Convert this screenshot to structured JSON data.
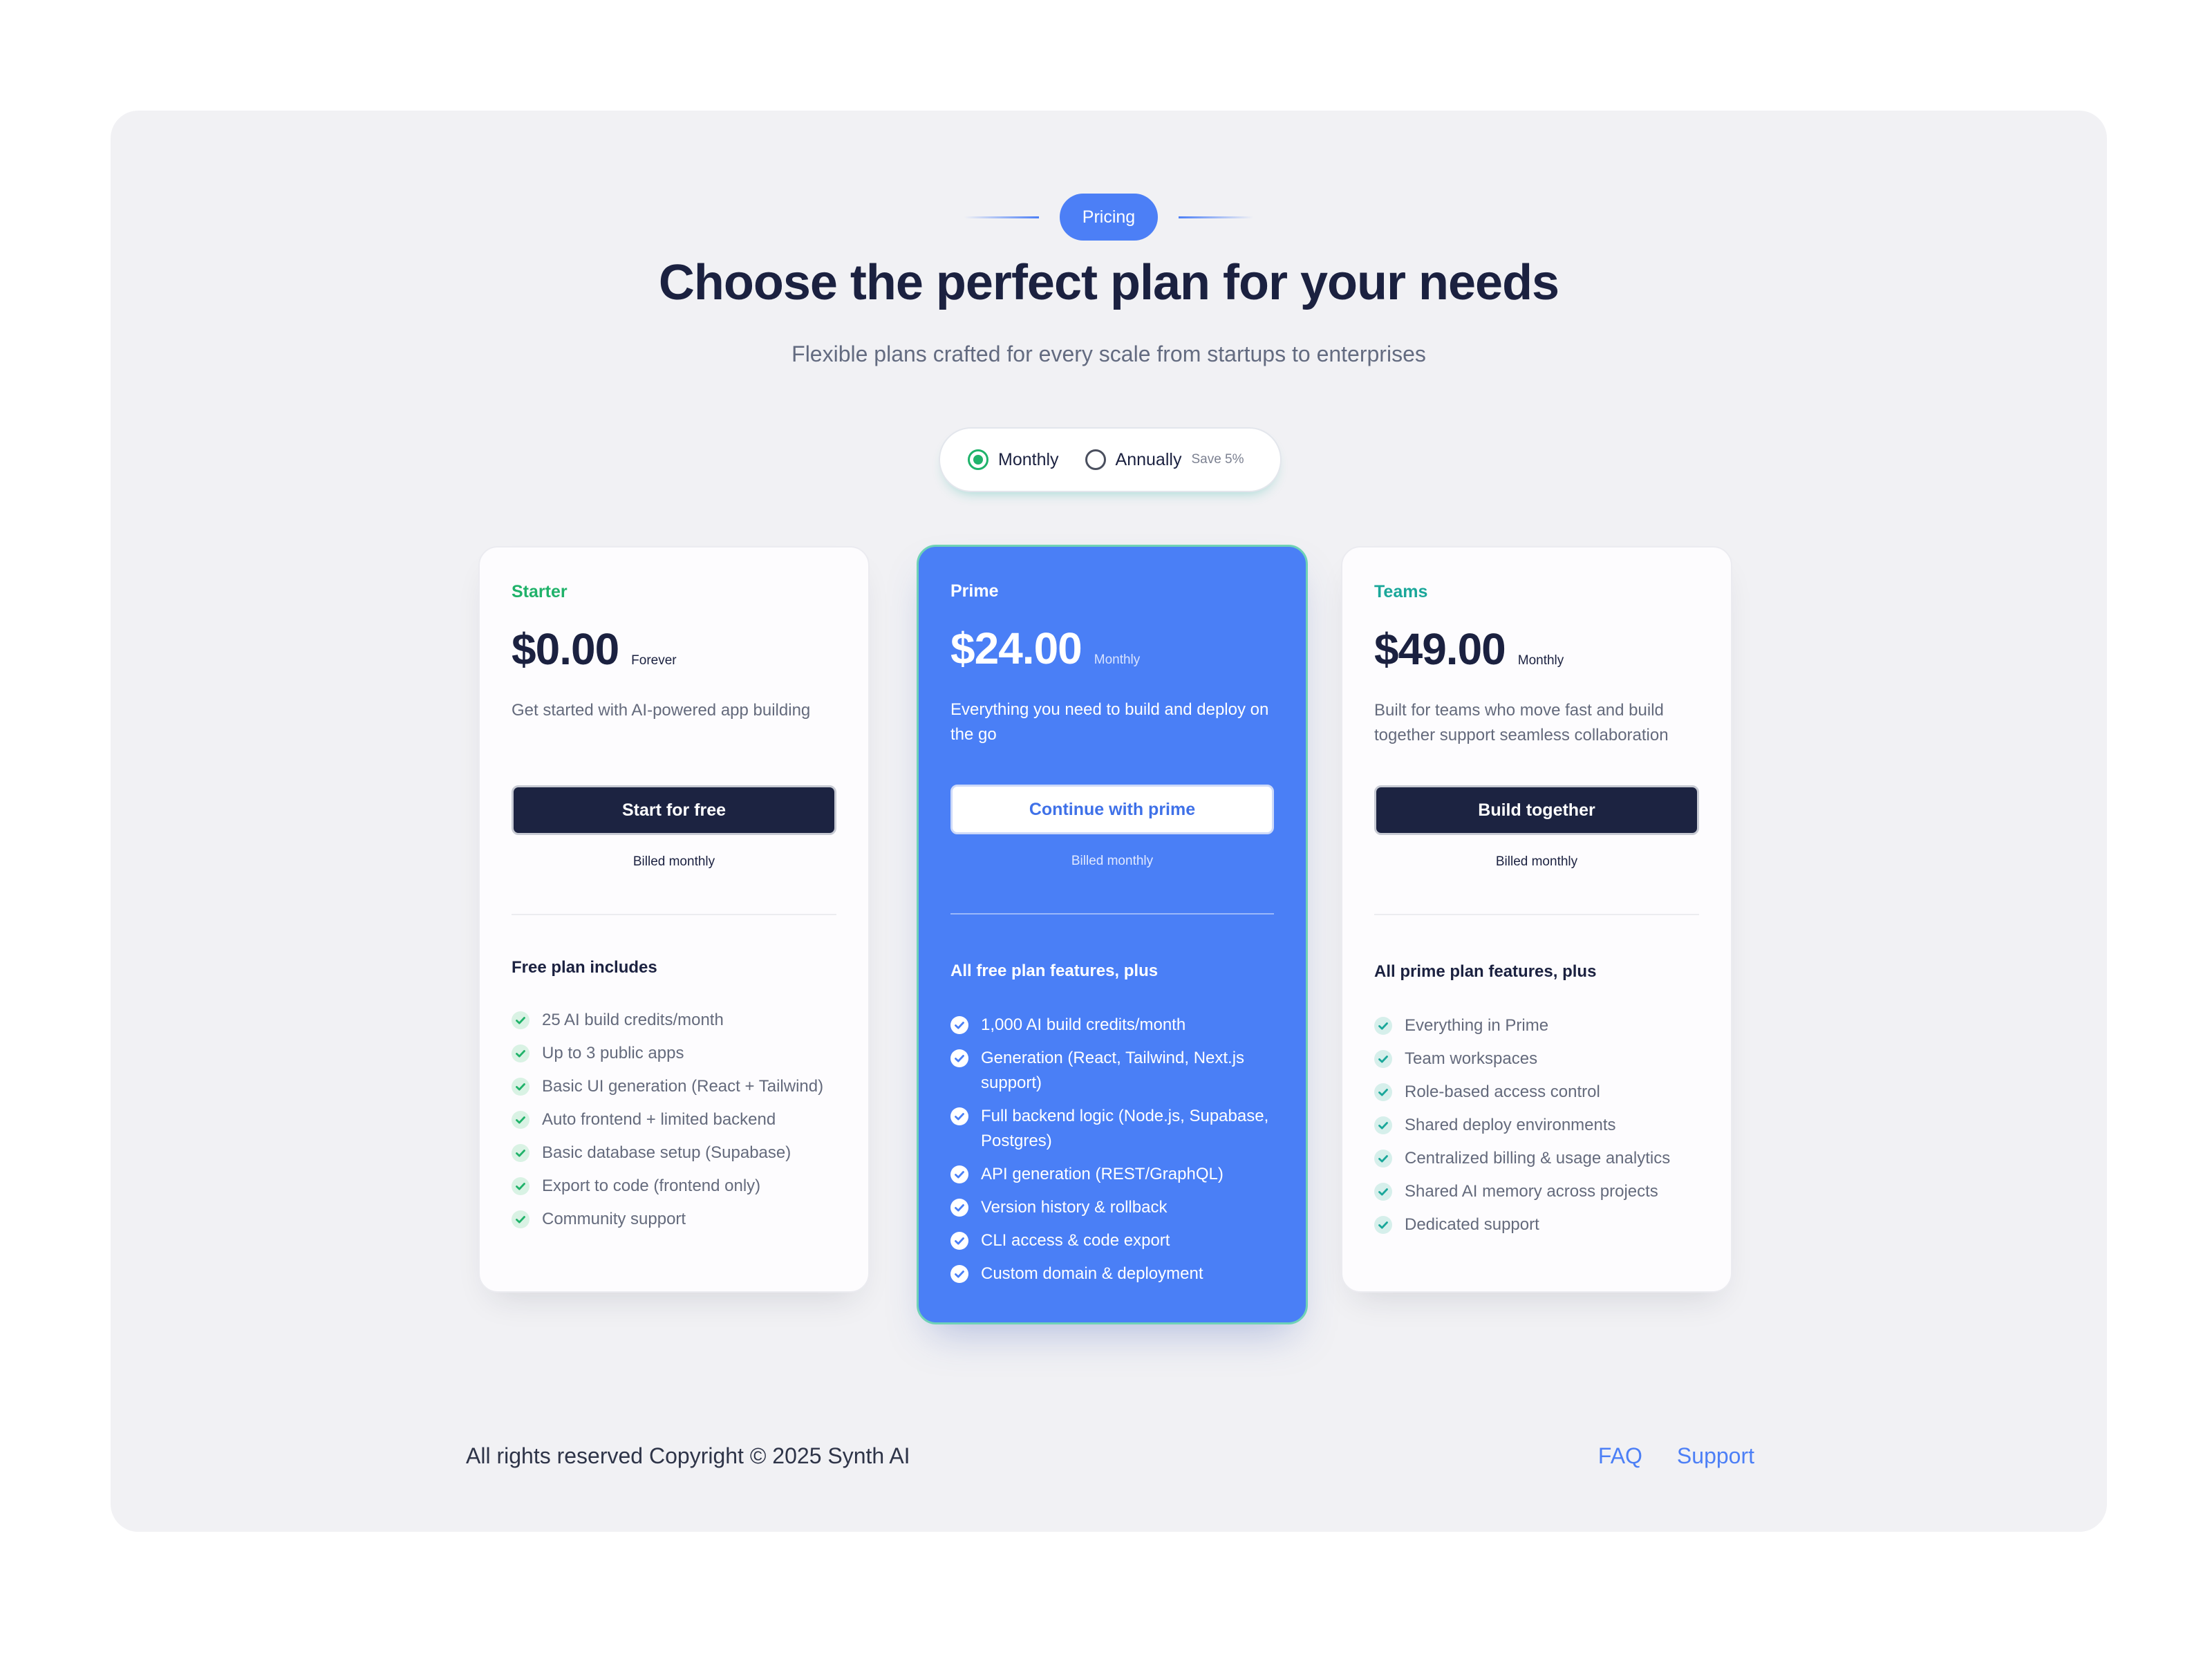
{
  "badge": "Pricing",
  "headline": "Choose the perfect plan for your needs",
  "subline": "Flexible plans crafted for every scale from startups to enterprises",
  "billing_toggle": {
    "monthly_label": "Monthly",
    "annually_label": "Annually",
    "save_label": "Save 5%",
    "selected": "Monthly"
  },
  "plans": [
    {
      "name": "Starter",
      "price": "$0.00",
      "period": "Forever",
      "description": "Get started with AI-powered app building",
      "cta": "Start for free",
      "billed": "Billed monthly",
      "features_title": "Free plan includes",
      "features": [
        "25 AI build credits/month",
        "Up to 3 public apps",
        "Basic UI generation (React + Tailwind)",
        "Auto frontend + limited backend",
        "Basic database setup (Supabase)",
        "Export to code (frontend only)",
        "Community support"
      ]
    },
    {
      "name": "Prime",
      "price": "$24.00",
      "period": "Monthly",
      "description": "Everything you need to build and deploy on the go",
      "cta": "Continue with prime",
      "billed": "Billed monthly",
      "features_title": "All free plan features, plus",
      "features": [
        "1,000 AI build credits/month",
        "Generation (React, Tailwind, Next.js support)",
        "Full backend logic (Node.js, Supabase, Postgres)",
        "API generation (REST/GraphQL)",
        "Version history & rollback",
        "CLI access & code export",
        "Custom domain & deployment"
      ]
    },
    {
      "name": "Teams",
      "price": "$49.00",
      "period": "Monthly",
      "description": "Built for teams who move fast and build together support seamless collaboration",
      "cta": "Build together",
      "billed": "Billed monthly",
      "features_title": "All prime plan features, plus",
      "features": [
        "Everything in Prime",
        "Team workspaces",
        "Role-based access control",
        "Shared deploy environments",
        "Centralized billing & usage analytics",
        "Shared AI memory across projects",
        "Dedicated support"
      ]
    }
  ],
  "footer": {
    "copyright": "All rights reserved Copyright © 2025 Synth AI",
    "links": [
      "FAQ",
      "Support"
    ]
  },
  "colors": {
    "accent": "#4c7ff6",
    "dark": "#1c2341",
    "green": "#1fb36b",
    "teal": "#1aa79a"
  }
}
